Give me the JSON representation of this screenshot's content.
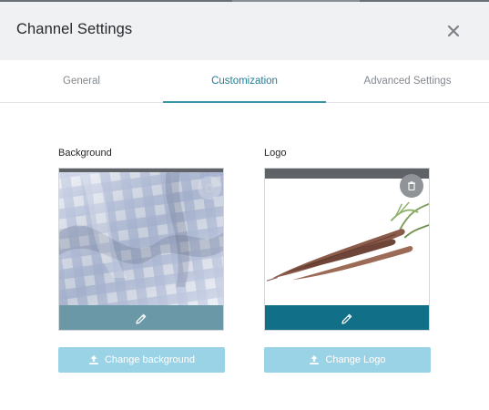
{
  "dialog": {
    "title": "Channel Settings",
    "close_icon": "close-icon"
  },
  "tabs": [
    {
      "label": "General",
      "active": false
    },
    {
      "label": "Customization",
      "active": true
    },
    {
      "label": "Advanced Settings",
      "active": false
    }
  ],
  "background": {
    "label": "Background",
    "image": "blue gingham fabric",
    "delete_icon": "trash-icon",
    "edit_icon": "pencil-icon",
    "button_label": "Change background",
    "button_icon": "upload-icon"
  },
  "logo": {
    "label": "Logo",
    "image": "carrots",
    "delete_icon": "trash-icon",
    "edit_icon": "pencil-icon",
    "button_label": "Change Logo",
    "button_icon": "upload-icon"
  },
  "colors": {
    "accent": "#1f7f96",
    "button_bg": "#9bd3e6",
    "logo_bar": "#126f88",
    "header_bg": "#f0f1f3"
  }
}
